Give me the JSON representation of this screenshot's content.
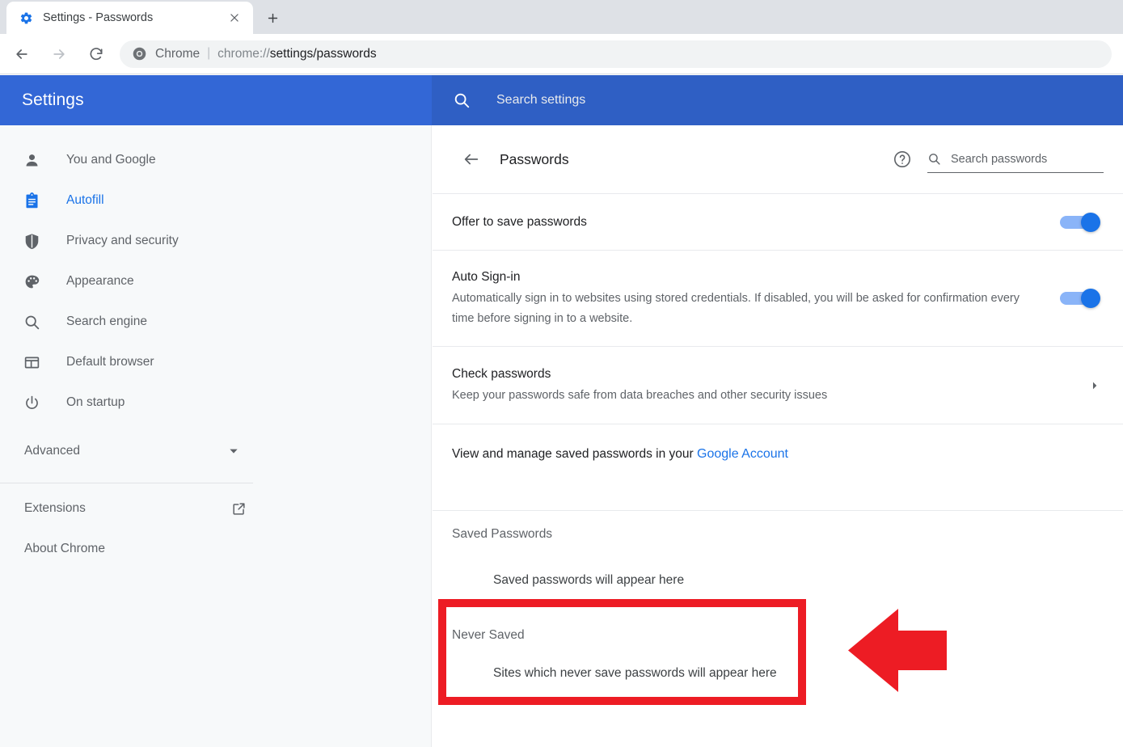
{
  "browser": {
    "tab": {
      "title": "Settings - Passwords",
      "favicon_icon": "gear-icon",
      "close_icon": "close-icon"
    },
    "new_tab_icon": "plus-icon",
    "nav": {
      "back_icon": "arrow-left-icon",
      "forward_icon": "arrow-right-icon",
      "reload_icon": "reload-icon"
    },
    "omnibox": {
      "site_icon": "chrome-logo-icon",
      "site_label": "Chrome",
      "separator": "|",
      "url_scheme": "chrome://",
      "url_path": "settings/passwords"
    }
  },
  "settings": {
    "title": "Settings",
    "search": {
      "icon": "search-icon",
      "placeholder": "Search settings"
    },
    "header_color": "#3367d6",
    "search_bg_color": "#2f5fc4"
  },
  "sidebar": {
    "items": [
      {
        "label": "You and Google",
        "icon": "person-icon",
        "active": false
      },
      {
        "label": "Autofill",
        "icon": "clipboard-icon",
        "active": true
      },
      {
        "label": "Privacy and security",
        "icon": "shield-icon",
        "active": false
      },
      {
        "label": "Appearance",
        "icon": "palette-icon",
        "active": false
      },
      {
        "label": "Search engine",
        "icon": "search-icon",
        "active": false
      },
      {
        "label": "Default browser",
        "icon": "browser-window-icon",
        "active": false
      },
      {
        "label": "On startup",
        "icon": "power-icon",
        "active": false
      }
    ],
    "advanced": {
      "label": "Advanced",
      "icon": "chevron-down-icon"
    },
    "links": [
      {
        "label": "Extensions",
        "icon": "external-link-icon"
      },
      {
        "label": "About Chrome",
        "icon": ""
      }
    ],
    "active_color": "#1a73e8"
  },
  "page": {
    "back_icon": "arrow-left-icon",
    "title": "Passwords",
    "help_icon": "help-circle-icon",
    "search": {
      "icon": "search-icon",
      "placeholder": "Search passwords"
    }
  },
  "rows": {
    "offer_to_save": {
      "title": "Offer to save passwords",
      "toggle_on": true
    },
    "auto_signin": {
      "title": "Auto Sign-in",
      "subtitle": "Automatically sign in to websites using stored credentials. If disabled, you will be asked for confirmation every time before signing in to a website.",
      "toggle_on": true
    },
    "check_passwords": {
      "title": "Check passwords",
      "subtitle": "Keep your passwords safe from data breaches and other security issues",
      "chevron_icon": "chevron-right-icon"
    },
    "manage": {
      "text_prefix": "View and manage saved passwords in your ",
      "link_label": "Google Account"
    },
    "saved_passwords": {
      "heading": "Saved Passwords",
      "empty_text": "Saved passwords will appear here"
    },
    "never_saved": {
      "heading": "Never Saved",
      "empty_text": "Sites which never save passwords will appear here"
    }
  },
  "annotations": {
    "highlight_box": {
      "target": "never-saved-section",
      "color": "#ed1c24"
    },
    "arrow": {
      "direction": "left",
      "color": "#ed1c24",
      "points_at": "never-saved-section"
    }
  }
}
